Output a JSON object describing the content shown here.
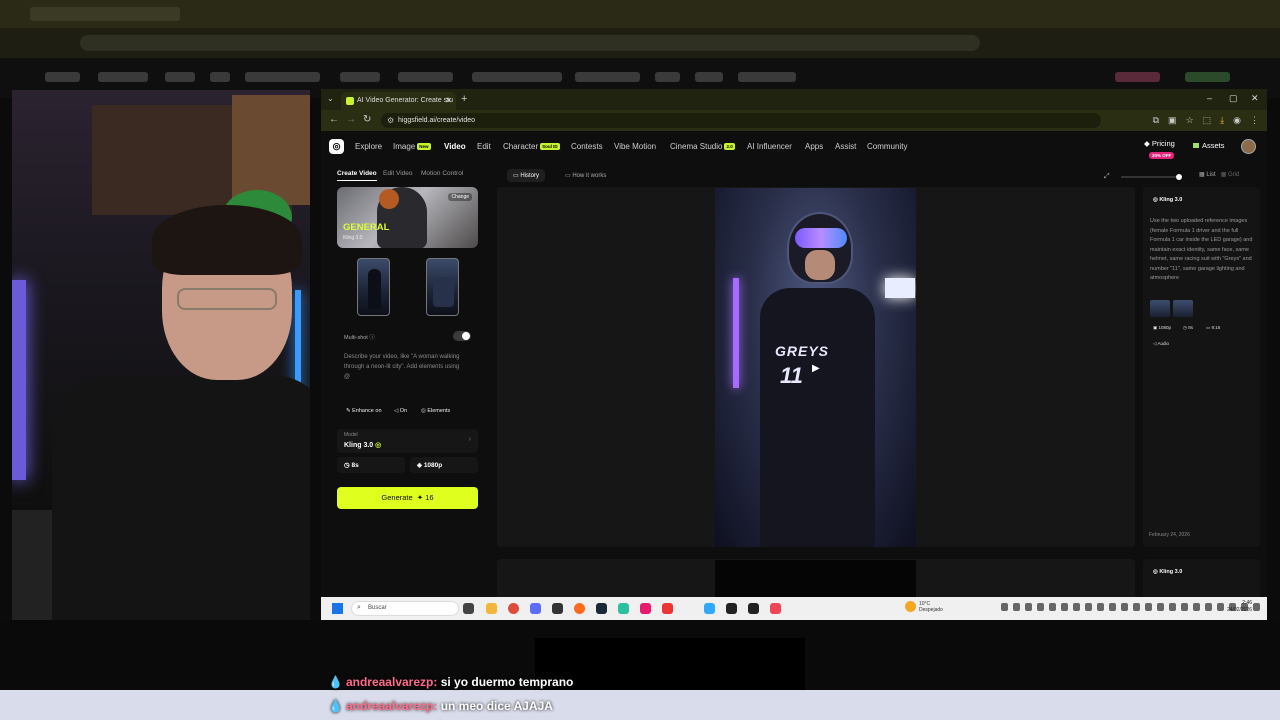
{
  "inner_browser": {
    "tab_title": "AI Video Generator: Create stu",
    "url": "higgsfield.ai/create/video"
  },
  "topnav": {
    "items": [
      {
        "label": "Explore"
      },
      {
        "label": "Image",
        "badge": "New"
      },
      {
        "label": "Video",
        "active": true
      },
      {
        "label": "Edit"
      },
      {
        "label": "Character",
        "badge": "Soul ID"
      },
      {
        "label": "Contests"
      },
      {
        "label": "Vibe Motion"
      },
      {
        "label": "Cinema Studio",
        "badge": "2.0"
      },
      {
        "label": "AI Influencer"
      },
      {
        "label": "Apps"
      },
      {
        "label": "Assist"
      },
      {
        "label": "Community"
      }
    ],
    "pricing": "Pricing",
    "pricing_badge": "20% OFF",
    "assets": "Assets"
  },
  "left_panel": {
    "tabs": [
      "Create Video",
      "Edit Video",
      "Motion Control"
    ],
    "preset_title": "GENERAL",
    "preset_subtitle": "Kling 3.0",
    "preset_change": "Change",
    "multishot_label": "Multi-shot",
    "prompt_placeholder": "Describe your video, like \"A woman walking through a neon-lit city\". Add elements using @",
    "chips": [
      "Enhance on",
      "On",
      "Elements"
    ],
    "model_label": "Model",
    "model_name": "Kling 3.0",
    "duration": "8s",
    "resolution": "1080p",
    "generate_label": "Generate",
    "generate_cost": "16"
  },
  "center": {
    "tabs": [
      "History",
      "How it works"
    ],
    "view_options": [
      "List",
      "Grid"
    ],
    "video_text": "GREYS",
    "video_number": "11"
  },
  "right_panel": {
    "model": "Kling 3.0",
    "prompt": "Use the two uploaded reference images (female Formula 1 driver and the full Formula 1 car inside the LED garage) and maintain exact identity, same face, same helmet, same racing suit with \"Greys\" and number \"11\", same garage lighting and atmosphere",
    "meta": [
      "1080p",
      "8s",
      "9:16"
    ],
    "audio": "Audio",
    "date": "February 24, 2026",
    "second_model": "Kling 3.0"
  },
  "taskbar": {
    "search_placeholder": "Buscar",
    "weather_temp": "10°C",
    "weather_desc": "Despejado",
    "time": "2:46",
    "date": "24/02/2026"
  },
  "chat": [
    {
      "user": "andreaalvarezp:",
      "message": "si yo duermo temprano"
    },
    {
      "user": "andreaalvarezp:",
      "message": "un meo dice AJAJA"
    }
  ],
  "colors": {
    "accent": "#dfff1f",
    "pink_badge": "#e4237a"
  }
}
